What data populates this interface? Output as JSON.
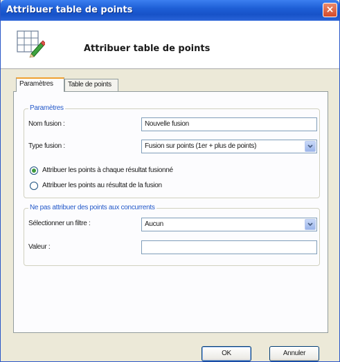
{
  "window": {
    "title": "Attribuer table de points",
    "close_label": "×"
  },
  "header": {
    "title": "Attribuer table de points",
    "icon": "table-edit-icon"
  },
  "tabs": [
    {
      "label": "Paramètres",
      "active": true
    },
    {
      "label": "Table de points",
      "active": false
    }
  ],
  "params_group": {
    "legend": "Paramètres",
    "nom_fusion_label": "Nom fusion :",
    "nom_fusion_value": "Nouvelle fusion",
    "type_fusion_label": "Type fusion :",
    "type_fusion_value": "Fusion sur points (1er + plus de points)",
    "radio1_label": "Attribuer les points à chaque résultat fusionné",
    "radio1_checked": true,
    "radio2_label": "Attribuer les points au résultat de la fusion",
    "radio2_checked": false
  },
  "filter_group": {
    "legend": "Ne pas attribuer des points aux concurrents",
    "filtre_label": "Sélectionner un filtre :",
    "filtre_value": "Aucun",
    "valeur_label": "Valeur :",
    "valeur_value": ""
  },
  "buttons": {
    "ok_label": "OK",
    "cancel_label": "Annuler"
  },
  "colors": {
    "titlebar": "#1e5fd6",
    "group_legend": "#2459c9",
    "active_tab_accent": "#f0a030",
    "dialog_bg": "#ece9d8"
  }
}
